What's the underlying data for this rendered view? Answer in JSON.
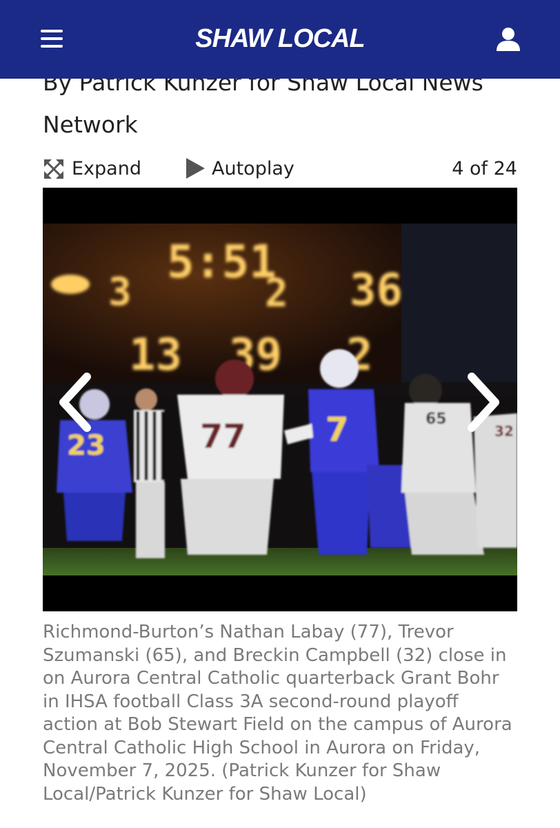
{
  "header": {
    "logo_text": "SHAW LOCAL",
    "menu_icon": "hamburger-menu-icon",
    "account_icon": "user-account-icon",
    "background_color": "#1b2a86"
  },
  "article": {
    "byline_line1": "By Patrick Kunzer for Shaw Local News",
    "byline_line2": "Network"
  },
  "gallery": {
    "expand_label": "Expand",
    "autoplay_label": "Autoplay",
    "counter": "4 of 24",
    "prev_icon": "chevron-left-icon",
    "next_icon": "chevron-right-icon",
    "scoreboard": {
      "clock": "5:51",
      "quarter": "2",
      "score_left": "3",
      "score_right": "36",
      "row2_left": "13",
      "row2_mid": "39",
      "row2_right": "2"
    },
    "jersey_numbers": {
      "home_left": "23",
      "visitor_center": "77",
      "quarterback": "7",
      "visitor_right": "65",
      "visitor_edge": "32"
    },
    "caption": "Richmond-Burton’s Nathan Labay (77), Trevor Szumanski (65), and Breckin Campbell (32) close in on Aurora Central Catholic quarterback Grant Bohr in IHSA football Class 3A second-round playoff action at Bob Stewart Field on the campus of Aurora Central Catholic High School in Aurora on Friday, November 7, 2025. (Patrick Kunzer for Shaw Local/Patrick Kunzer for Shaw Local)"
  }
}
